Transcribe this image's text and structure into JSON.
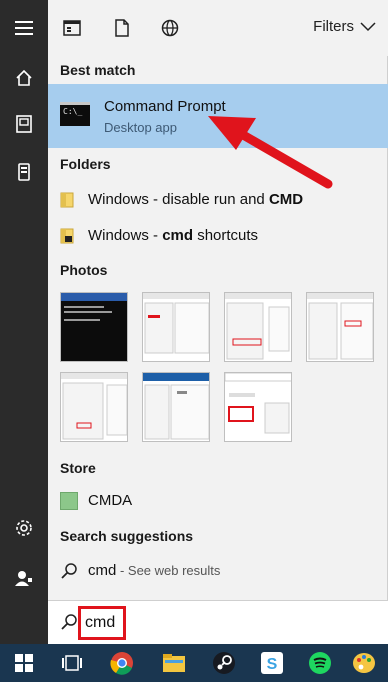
{
  "rail": {
    "icons": [
      "hamburger-icon",
      "home-icon",
      "documents-icon",
      "phone-icon",
      "settings-icon",
      "user-icon"
    ]
  },
  "topbar": {
    "icons": [
      "apps-icon",
      "document-icon",
      "web-icon"
    ],
    "filters_label": "Filters"
  },
  "best_match": {
    "section_label": "Best match",
    "title": "Command Prompt",
    "subtitle": "Desktop app",
    "icon_text": "C:\\_"
  },
  "folders": {
    "section_label": "Folders",
    "items": [
      {
        "prefix": "Windows - disable run and ",
        "bold": "CMD",
        "suffix": ""
      },
      {
        "prefix": "Windows - ",
        "bold": "cmd",
        "suffix": " shortcuts"
      }
    ]
  },
  "photos": {
    "section_label": "Photos",
    "count": 7
  },
  "store": {
    "section_label": "Store",
    "item_label": "CMDA"
  },
  "suggestions": {
    "section_label": "Search suggestions",
    "query": "cmd",
    "hint": " - See web results"
  },
  "search": {
    "query": "cmd"
  },
  "taskbar": {
    "icons": [
      "windows-start-icon",
      "task-view-icon",
      "chrome-icon",
      "file-explorer-icon",
      "steam-icon",
      "slack-icon",
      "spotify-icon",
      "paint-icon"
    ]
  },
  "colors": {
    "rail_bg": "#2b2b2b",
    "panel_bg": "#f2f2f2",
    "highlight": "#a6cdee",
    "annotation_red": "#e0141c",
    "taskbar_bg": "#1a3650"
  }
}
